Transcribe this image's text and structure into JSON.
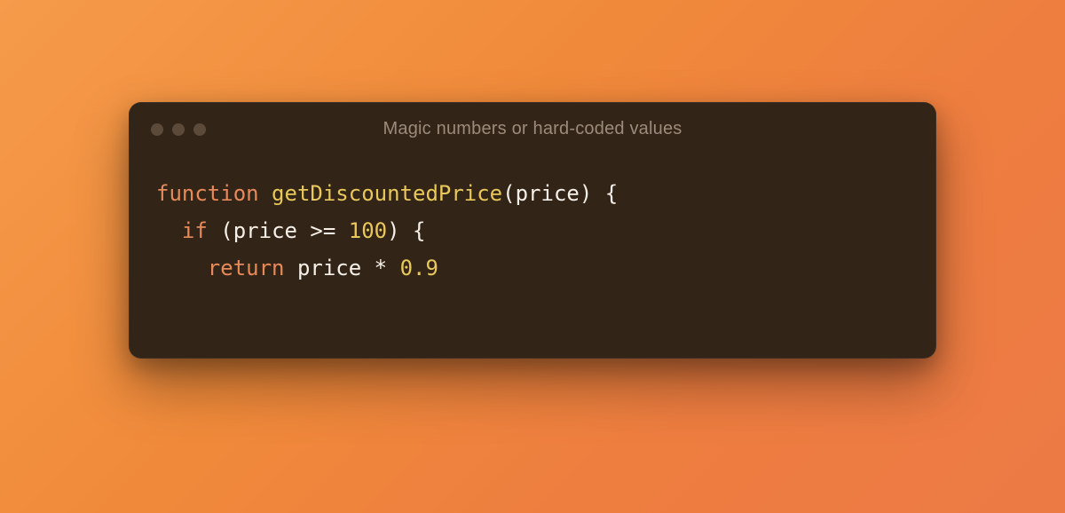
{
  "window": {
    "title": "Magic numbers or hard-coded values"
  },
  "code": {
    "line1": {
      "kw_function": "function",
      "space1": " ",
      "fn_name": "getDiscountedPrice",
      "paren_open": "(",
      "param": "price",
      "paren_close": ")",
      "space2": " ",
      "brace_open": "{"
    },
    "line2": {
      "indent": "  ",
      "kw_if": "if",
      "space1": " ",
      "paren_open": "(",
      "var": "price",
      "space2": " ",
      "op": ">=",
      "space3": " ",
      "num": "100",
      "paren_close": ")",
      "space4": " ",
      "brace_open": "{"
    },
    "line3": {
      "indent": "    ",
      "kw_return": "return",
      "space1": " ",
      "var": "price",
      "space2": " ",
      "op": "*",
      "space3": " ",
      "num": "0.9"
    }
  }
}
